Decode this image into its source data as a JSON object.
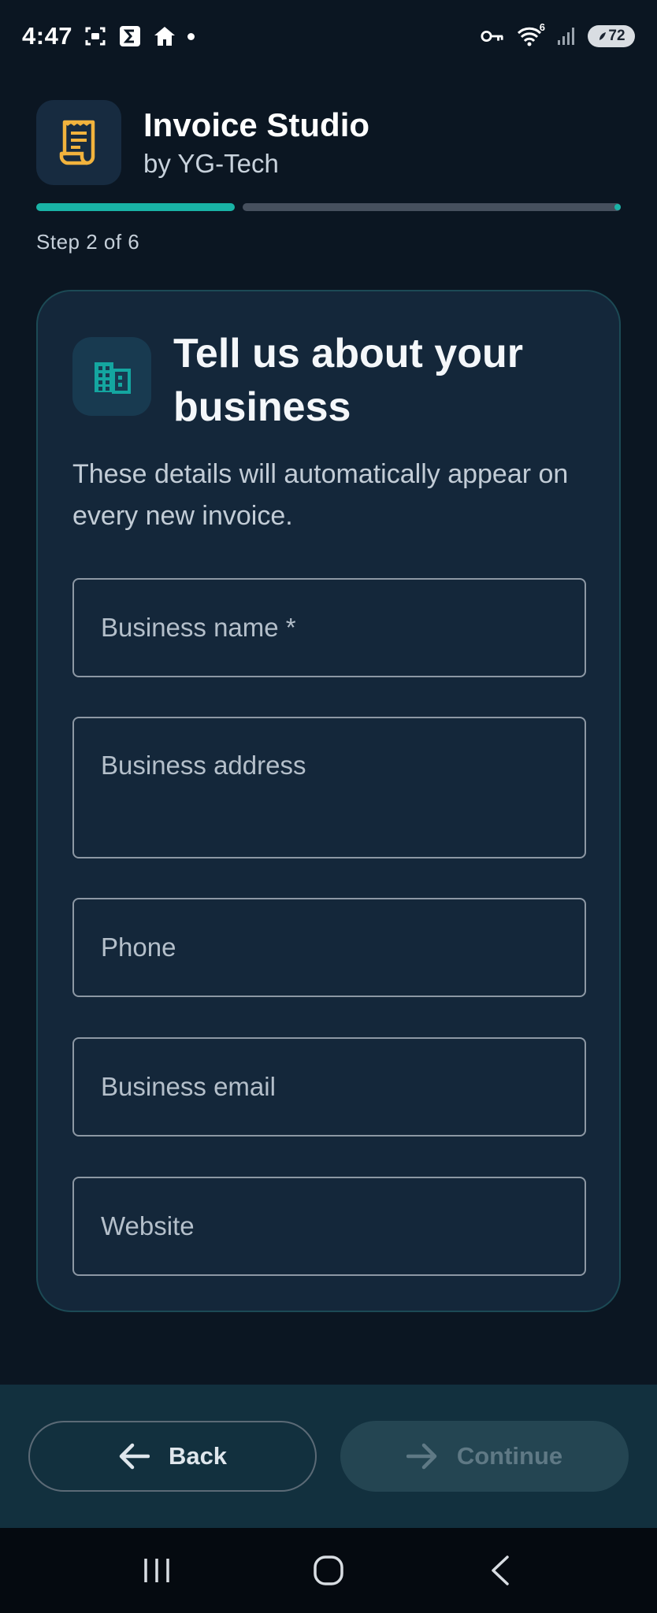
{
  "status_bar": {
    "time": "4:47",
    "battery": "72",
    "wifi_badge": "6",
    "left_icons": [
      "screenshot-icon",
      "sigma-app-icon",
      "home-app-icon",
      "notification-dot"
    ],
    "right_icons": [
      "vpn-key-icon",
      "wifi-icon",
      "signal-icon",
      "battery-icon"
    ]
  },
  "header": {
    "app_name": "Invoice Studio",
    "developer": "by YG-Tech",
    "logo_icon": "receipt-icon"
  },
  "progress": {
    "step_label": "Step 2 of 6",
    "current_step": 2,
    "total_steps": 6,
    "accent": "#19b3a6"
  },
  "card": {
    "icon": "building-icon",
    "title": "Tell us about your business",
    "description": "These details will automatically appear on every new invoice."
  },
  "form": {
    "business_name_placeholder": "Business name *",
    "business_address_placeholder": "Business address",
    "phone_placeholder": "Phone",
    "email_placeholder": "Business email",
    "website_placeholder": "Website"
  },
  "actions": {
    "back_label": "Back",
    "continue_label": "Continue",
    "continue_enabled": false
  },
  "nav": {
    "items": [
      "recents-icon",
      "home-icon",
      "back-icon"
    ]
  }
}
